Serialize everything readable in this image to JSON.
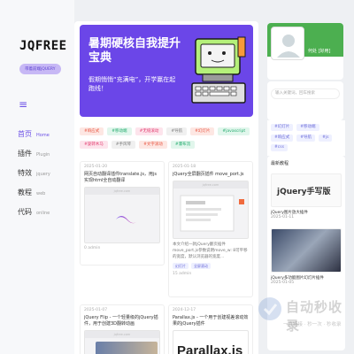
{
  "sidebar": {
    "logo": "JQFREE",
    "pill": "带着前端jQUERY",
    "menu_icon": "hamburger-icon",
    "nav": [
      {
        "zh": "首页",
        "en": "Home",
        "active": true
      },
      {
        "zh": "插件",
        "en": "Plugin",
        "active": false
      },
      {
        "zh": "特效",
        "en": "jquery",
        "active": false
      },
      {
        "zh": "教程",
        "en": "web",
        "active": false
      },
      {
        "zh": "代码",
        "en": "online",
        "active": false
      }
    ]
  },
  "banner": {
    "title": "暑期硬核自我提升宝典",
    "subtitle": "假期悄悄“充满电”，开学赢在起跑线！"
  },
  "tags": [
    {
      "label": "#响应式",
      "color": "#e8533f",
      "bg": "#fde7e3"
    },
    {
      "label": "#移动端",
      "color": "#1faa6b",
      "bg": "#e1f6ec"
    },
    {
      "label": "#无缝滚动",
      "color": "#e23b6e",
      "bg": "#fde4ec"
    },
    {
      "label": "#导航",
      "color": "#7a7a7a",
      "bg": "#f0f0f0"
    },
    {
      "label": "#幻灯片",
      "color": "#e8533f",
      "bg": "#fde7e3"
    },
    {
      "label": "#javascript",
      "color": "#1faa6b",
      "bg": "#e1f6ec"
    },
    {
      "label": "#旋转木马",
      "color": "#e23b6e",
      "bg": "#fde4ec"
    },
    {
      "label": "#手风琴",
      "color": "#7a7a7a",
      "bg": "#f0f0f0"
    },
    {
      "label": "#文字滚动",
      "color": "#e8533f",
      "bg": "#fde7e3"
    },
    {
      "label": "#瀑布流",
      "color": "#1faa6b",
      "bg": "#e1f6ec"
    }
  ],
  "cards": [
    {
      "date": "2025-01-20",
      "title": "网页自动翻译插件translate.js，用js实现html全自动翻译",
      "url": "jqfree.com",
      "meta": "0  admin"
    },
    {
      "date": "2025-01-18",
      "title": "jQuery全屏翻页插件 move_port.js",
      "url": "jqfree.com",
      "desc": "本文介绍一款jQuery翻页插件 move_port.js参数说明move_w: 8可平移的宽度，默认浏览器的宽度...",
      "mini_tags": [
        "幻灯片",
        "全屏滚动"
      ],
      "meta": "15  admin"
    },
    {
      "date": "2025-01-07",
      "title": "jQuery Flip - 一个轻量级的jQuery插件，用于创建3D翻转动画",
      "url": "jqfree.com"
    },
    {
      "date": "2024-12-17",
      "title": "Parallax.js - 一个用于创建视差滚动效果的jQuery插件",
      "big": "Parallax.js"
    }
  ],
  "right": {
    "profile_name": "何处 [好用]",
    "search_placeholder": "输入关键词，回车搜索",
    "rtags": [
      "#幻灯片",
      "#移动端",
      "#响应式",
      "#导航",
      "#js",
      "#css"
    ],
    "latest_head": "最新教程",
    "latest": [
      {
        "title": "jQuery手写版",
        "desc": "jQuery图片放大插件",
        "date": "2025-01-11"
      },
      {
        "title": "jQuery多功能图片幻灯片插件",
        "desc": "",
        "date": "2025-01-05"
      }
    ]
  },
  "watermark": {
    "main": "自动秒收录",
    "sub": "一直链接 · 秒一次 · 秒收录"
  }
}
